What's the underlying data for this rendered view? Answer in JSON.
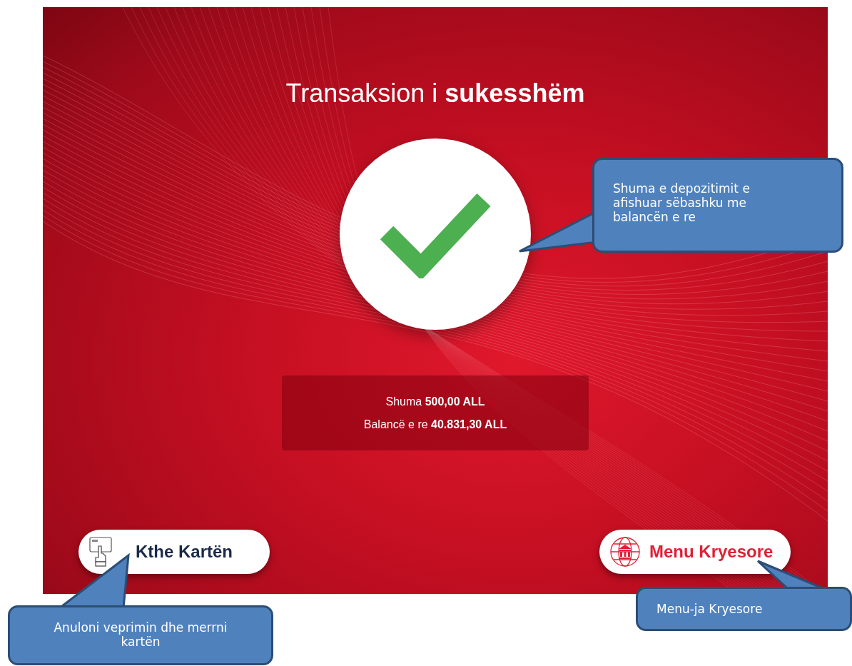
{
  "screen": {
    "title": "Transaksion i **sukesshëm**",
    "summary": [
      "Shuma **500,00 ALL**",
      "Balancë e re **40.831,30 ALL**"
    ],
    "buttons": [
      {
        "label": "Kthe Kartën",
        "kind": "return-card"
      },
      {
        "label": "Menu Kryesore",
        "kind": "main-menu"
      }
    ]
  },
  "callouts": [
    {
      "text": "Shuma e depozitimit e afishuar sëbashku me balancën e re"
    },
    {
      "text": "Anuloni veprimin dhe merrni kartën"
    },
    {
      "text": "Menu-ja Kryesore"
    }
  ]
}
